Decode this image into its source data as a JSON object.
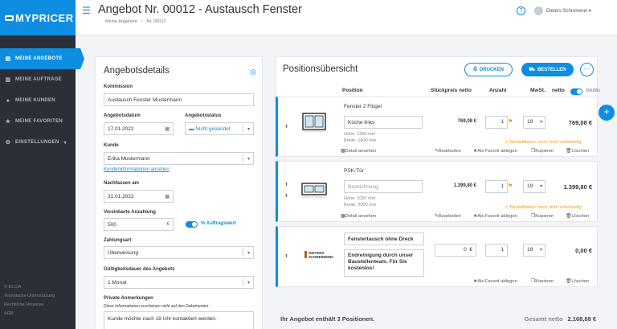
{
  "sidebar": {
    "logo": "MYPRICER",
    "items": [
      {
        "label": "MEINE ANGEBOTE",
        "icon": "document-icon",
        "active": true
      },
      {
        "label": "MEINE AUFTRÄGE",
        "icon": "orders-icon"
      },
      {
        "label": "MEINE KUNDEN",
        "icon": "user-icon"
      },
      {
        "label": "MEINE FAVORITEN",
        "icon": "star-icon"
      },
      {
        "label": "EINSTELLUNGEN",
        "icon": "gear-icon"
      }
    ],
    "footer": [
      "© ELCIA",
      "Technische Unterstützung",
      "Rechtliche Hinweise",
      "AGB"
    ]
  },
  "header": {
    "title": "Angebot Nr. 00012 - Austausch Fenster",
    "breadcrumb": [
      "Meine Angebote",
      "›",
      "Nr. 00012"
    ],
    "user": "Dieters Schreinerei"
  },
  "details": {
    "title": "Angebotsdetails",
    "kommission_label": "Kommission",
    "kommission": "Austausch Fenster Mustermann",
    "datum_label": "Angebotsdatum",
    "datum": "17.01.2022",
    "status_label": "Angebotsstatus",
    "status": "Nicht gesendet",
    "kunde_label": "Kunde",
    "kunde": "Erika Mustermann",
    "kunde_link": "Kundeninformationen ansehen",
    "nachfassen_label": "Nachfassen am",
    "nachfassen": "31.01.2022",
    "anzahlung_label": "Vereinbarte Anzahlung",
    "anzahlung": "500",
    "anzahlung_unit": "€",
    "auftragswert_label": "% Auftragswert",
    "zahlungsart_label": "Zahlungsart",
    "zahlungsart": "Überweisung",
    "gueltig_label": "Gültigkeitsdauer des Angebots",
    "gueltig": "1 Monat",
    "anm_label": "Private Anmerkungen",
    "anm_note": "Diese Informationen erscheinen nicht auf den Dokumenten",
    "anm": "Kunde möchte nach 18 Uhr kontaktiert werden."
  },
  "positions": {
    "title": "Positionsübersicht",
    "print": "DRUCKEN",
    "order": "BESTELLEN",
    "columns": {
      "position": "Position",
      "price": "Stückpreis netto",
      "qty": "Anzahl",
      "vat": "MwSt.",
      "netto": "netto",
      "brutto": "brutto"
    },
    "items": [
      {
        "name": "Fenster 2 Flügel",
        "label": "Küche links",
        "h": "Höhe: 1350 mm",
        "b": "Breite: 1400 mm",
        "price": "769,08 €",
        "qty": "1",
        "vat": "19",
        "total": "769,08 €",
        "warn": "Bestelldaten noch nicht vollständig"
      },
      {
        "name": "PSK-Tür",
        "placeholder": "Bezeichnung",
        "h": "Höhe: 1050 mm",
        "b": "Breite: 2000 mm",
        "price": "1.399,80 €",
        "qty": "1",
        "vat": "19",
        "total": "1.399,80 €",
        "warn": "Bestelldaten noch nicht vollständig"
      },
      {
        "name": "Fenstertausch ohne Dreck",
        "desc": "Endreinigung durch unser Baustellenteam. Für Sie kostenlos!",
        "logo": "DIETERS SCHREINEREI",
        "price": "0",
        "price_unit": "€",
        "qty": "1",
        "vat": "19",
        "total": "0,00 €"
      }
    ],
    "actions": {
      "detail": "Detail ansehen",
      "edit": "Bearbeiten",
      "fav": "Als Favorit ablegen",
      "copy": "Kopieren",
      "del": "Löschen"
    },
    "summary": "Ihr Angebot enthält 3 Positionen.",
    "gesamt_label": "Gesamt netto",
    "gesamt": "2.168,88 €"
  }
}
